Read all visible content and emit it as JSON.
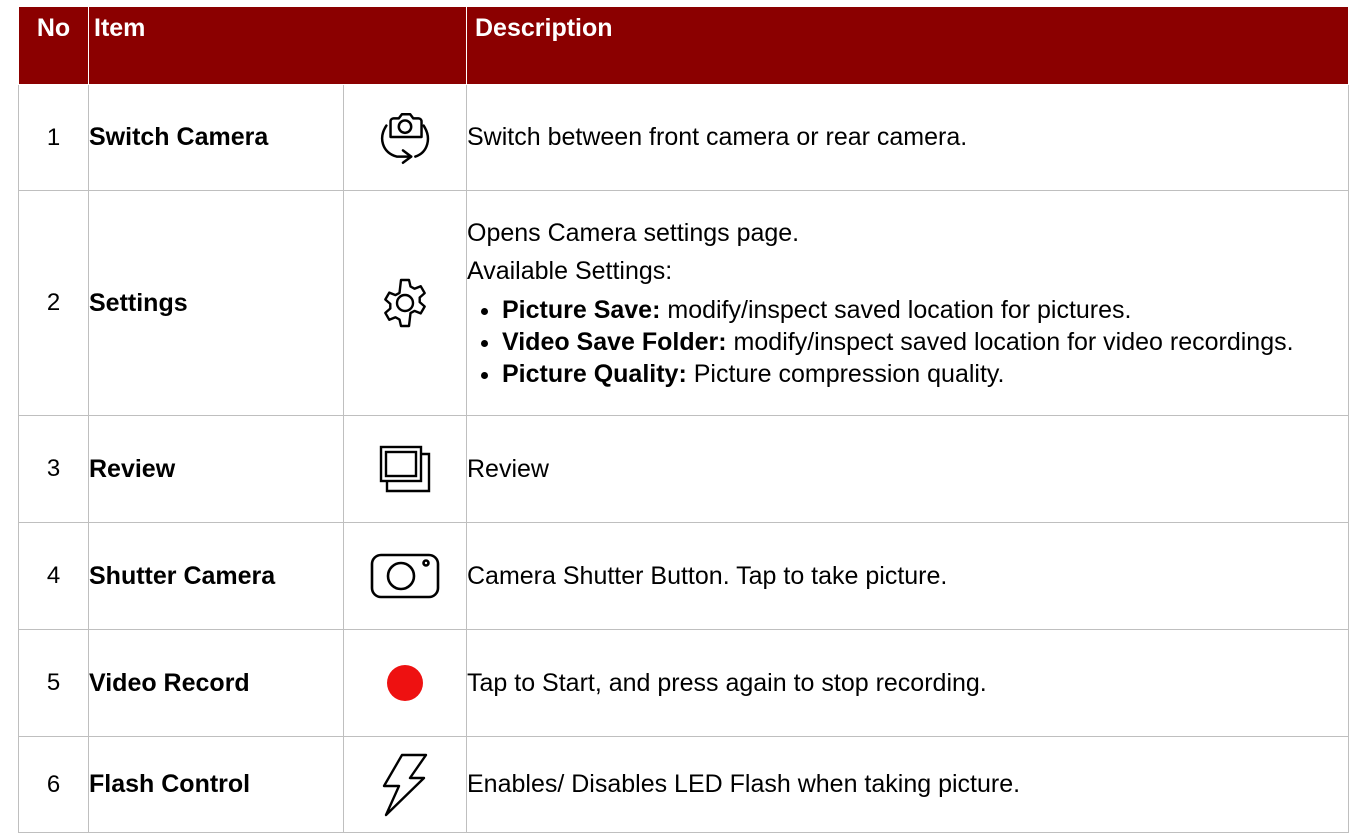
{
  "header": {
    "no": "No",
    "item": "Item",
    "description": "Description"
  },
  "rows": [
    {
      "no": "1",
      "item": "Switch Camera",
      "icon": "switch-camera-icon",
      "description": "Switch between front camera or rear camera."
    },
    {
      "no": "2",
      "item": "Settings",
      "icon": "gear-icon",
      "description_lines": [
        "Opens Camera settings page.",
        "Available Settings:"
      ],
      "bullets": [
        {
          "label": "Picture Save:",
          "text": " modify/inspect saved location for pictures."
        },
        {
          "label": "Video Save Folder:",
          "text": " modify/inspect saved location for video recordings."
        },
        {
          "label": "Picture Quality:",
          "text": " Picture compression quality."
        }
      ]
    },
    {
      "no": "3",
      "item": "Review",
      "icon": "gallery-stack-icon",
      "description": "Review"
    },
    {
      "no": "4",
      "item": "Shutter Camera",
      "icon": "camera-shutter-icon",
      "description": "Camera Shutter Button. Tap to take picture."
    },
    {
      "no": "5",
      "item": "Video Record",
      "icon": "record-dot-icon",
      "description": "Tap to Start, and press again to stop recording."
    },
    {
      "no": "6",
      "item": "Flash Control",
      "icon": "lightning-icon",
      "description": "Enables/ Disables LED Flash when taking picture."
    }
  ],
  "colors": {
    "header_bg": "#8b0000",
    "record_red": "#ee1111",
    "border": "#bfbfbf"
  }
}
